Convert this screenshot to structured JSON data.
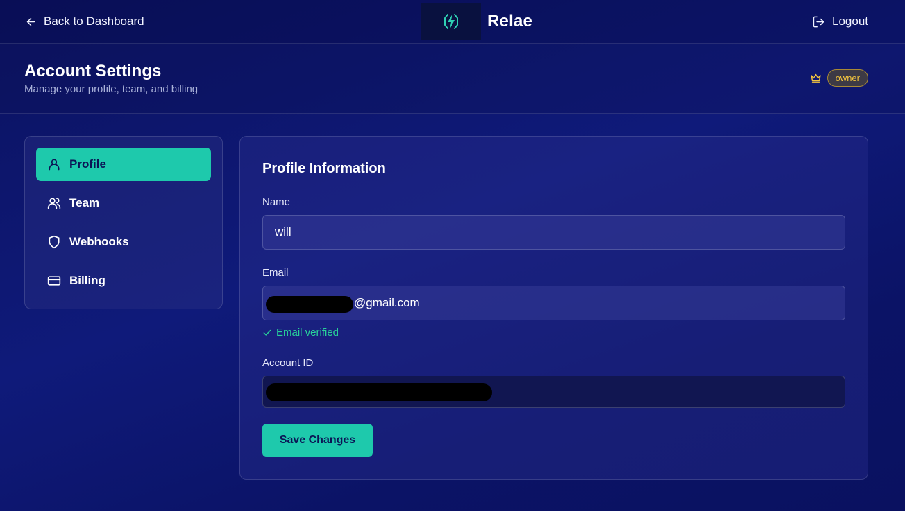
{
  "topbar": {
    "back_label": "Back to Dashboard",
    "brand_name": "Relae",
    "logout_label": "Logout"
  },
  "header": {
    "title": "Account Settings",
    "subtitle": "Manage your profile, team, and billing",
    "role": "owner"
  },
  "sidebar": {
    "items": [
      {
        "label": "Profile",
        "icon": "user-icon",
        "active": true
      },
      {
        "label": "Team",
        "icon": "users-icon",
        "active": false
      },
      {
        "label": "Webhooks",
        "icon": "shield-icon",
        "active": false
      },
      {
        "label": "Billing",
        "icon": "credit-card-icon",
        "active": false
      }
    ]
  },
  "profile": {
    "section_title": "Profile Information",
    "name_label": "Name",
    "name_value": "will",
    "email_label": "Email",
    "email_value": "@gmail.com",
    "email_status": "Email verified",
    "account_id_label": "Account ID",
    "save_label": "Save Changes"
  },
  "colors": {
    "accent": "#1ec9ac",
    "background": "#0b1366",
    "verified": "#28d39a",
    "role_badge": "#f2c43f"
  }
}
